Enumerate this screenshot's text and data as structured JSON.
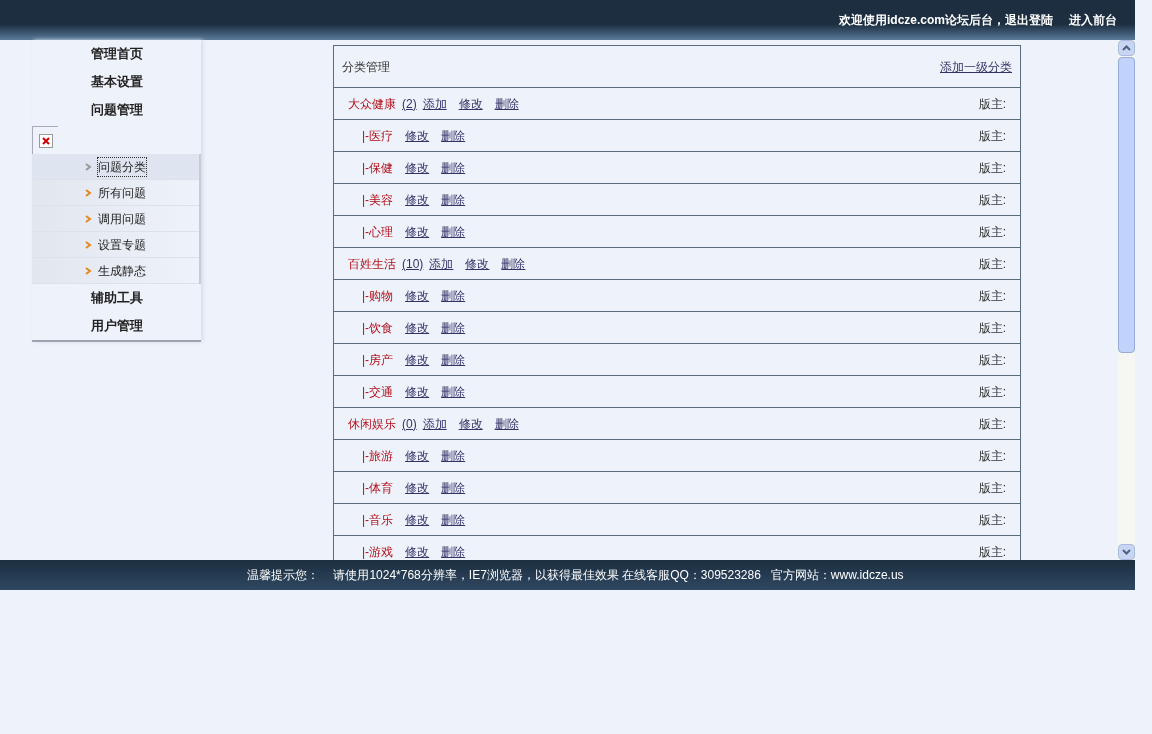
{
  "header": {
    "welcome": "欢迎使用idcze.com论坛后台，",
    "links": [
      "退出登陆",
      "进入前台"
    ]
  },
  "sidebar": {
    "items": [
      {
        "label": "管理首页"
      },
      {
        "label": "基本设置"
      },
      {
        "label": "问题管理",
        "children": [
          {
            "label": "问题分类",
            "selected": true
          },
          {
            "label": "所有问题",
            "selected": false
          },
          {
            "label": "调用问题",
            "selected": false
          },
          {
            "label": "设置专题",
            "selected": false
          },
          {
            "label": "生成静态",
            "selected": false
          }
        ]
      },
      {
        "label": "辅助工具"
      },
      {
        "label": "用户管理"
      }
    ]
  },
  "table": {
    "title": "分类管理",
    "add_link": "添加一级分类",
    "rows": [
      {
        "kind": "parent",
        "name": "大众健康",
        "count": "(2)",
        "actions": [
          "添加",
          "修改",
          "删除"
        ],
        "moderator": "版主:"
      },
      {
        "kind": "child",
        "name": "|-医疗",
        "actions": [
          "修改",
          "删除"
        ],
        "moderator": "版主:"
      },
      {
        "kind": "child",
        "name": "|-保健",
        "actions": [
          "修改",
          "删除"
        ],
        "moderator": "版主:"
      },
      {
        "kind": "child",
        "name": "|-美容",
        "actions": [
          "修改",
          "删除"
        ],
        "moderator": "版主:"
      },
      {
        "kind": "child",
        "name": "|-心理",
        "actions": [
          "修改",
          "删除"
        ],
        "moderator": "版主:"
      },
      {
        "kind": "parent",
        "name": "百姓生活",
        "count": "(10)",
        "actions": [
          "添加",
          "修改",
          "删除"
        ],
        "moderator": "版主:"
      },
      {
        "kind": "child",
        "name": "|-购物",
        "actions": [
          "修改",
          "删除"
        ],
        "moderator": "版主:"
      },
      {
        "kind": "child",
        "name": "|-饮食",
        "actions": [
          "修改",
          "删除"
        ],
        "moderator": "版主:"
      },
      {
        "kind": "child",
        "name": "|-房产",
        "actions": [
          "修改",
          "删除"
        ],
        "moderator": "版主:"
      },
      {
        "kind": "child",
        "name": "|-交通",
        "actions": [
          "修改",
          "删除"
        ],
        "moderator": "版主:"
      },
      {
        "kind": "parent",
        "name": "休闲娱乐",
        "count": "(0)",
        "actions": [
          "添加",
          "修改",
          "删除"
        ],
        "moderator": "版主:"
      },
      {
        "kind": "child",
        "name": "|-旅游",
        "actions": [
          "修改",
          "删除"
        ],
        "moderator": "版主:"
      },
      {
        "kind": "child",
        "name": "|-体育",
        "actions": [
          "修改",
          "删除"
        ],
        "moderator": "版主:"
      },
      {
        "kind": "child",
        "name": "|-音乐",
        "actions": [
          "修改",
          "删除"
        ],
        "moderator": "版主:"
      },
      {
        "kind": "child",
        "name": "|-游戏",
        "actions": [
          "修改",
          "删除"
        ],
        "moderator": "版主:"
      }
    ]
  },
  "footer": {
    "label": "温馨提示您：",
    "message": "请使用1024*768分辨率，IE7浏览器，以获得最佳效果 在线客服QQ：309523286   官方网站：www.idcze.us"
  }
}
